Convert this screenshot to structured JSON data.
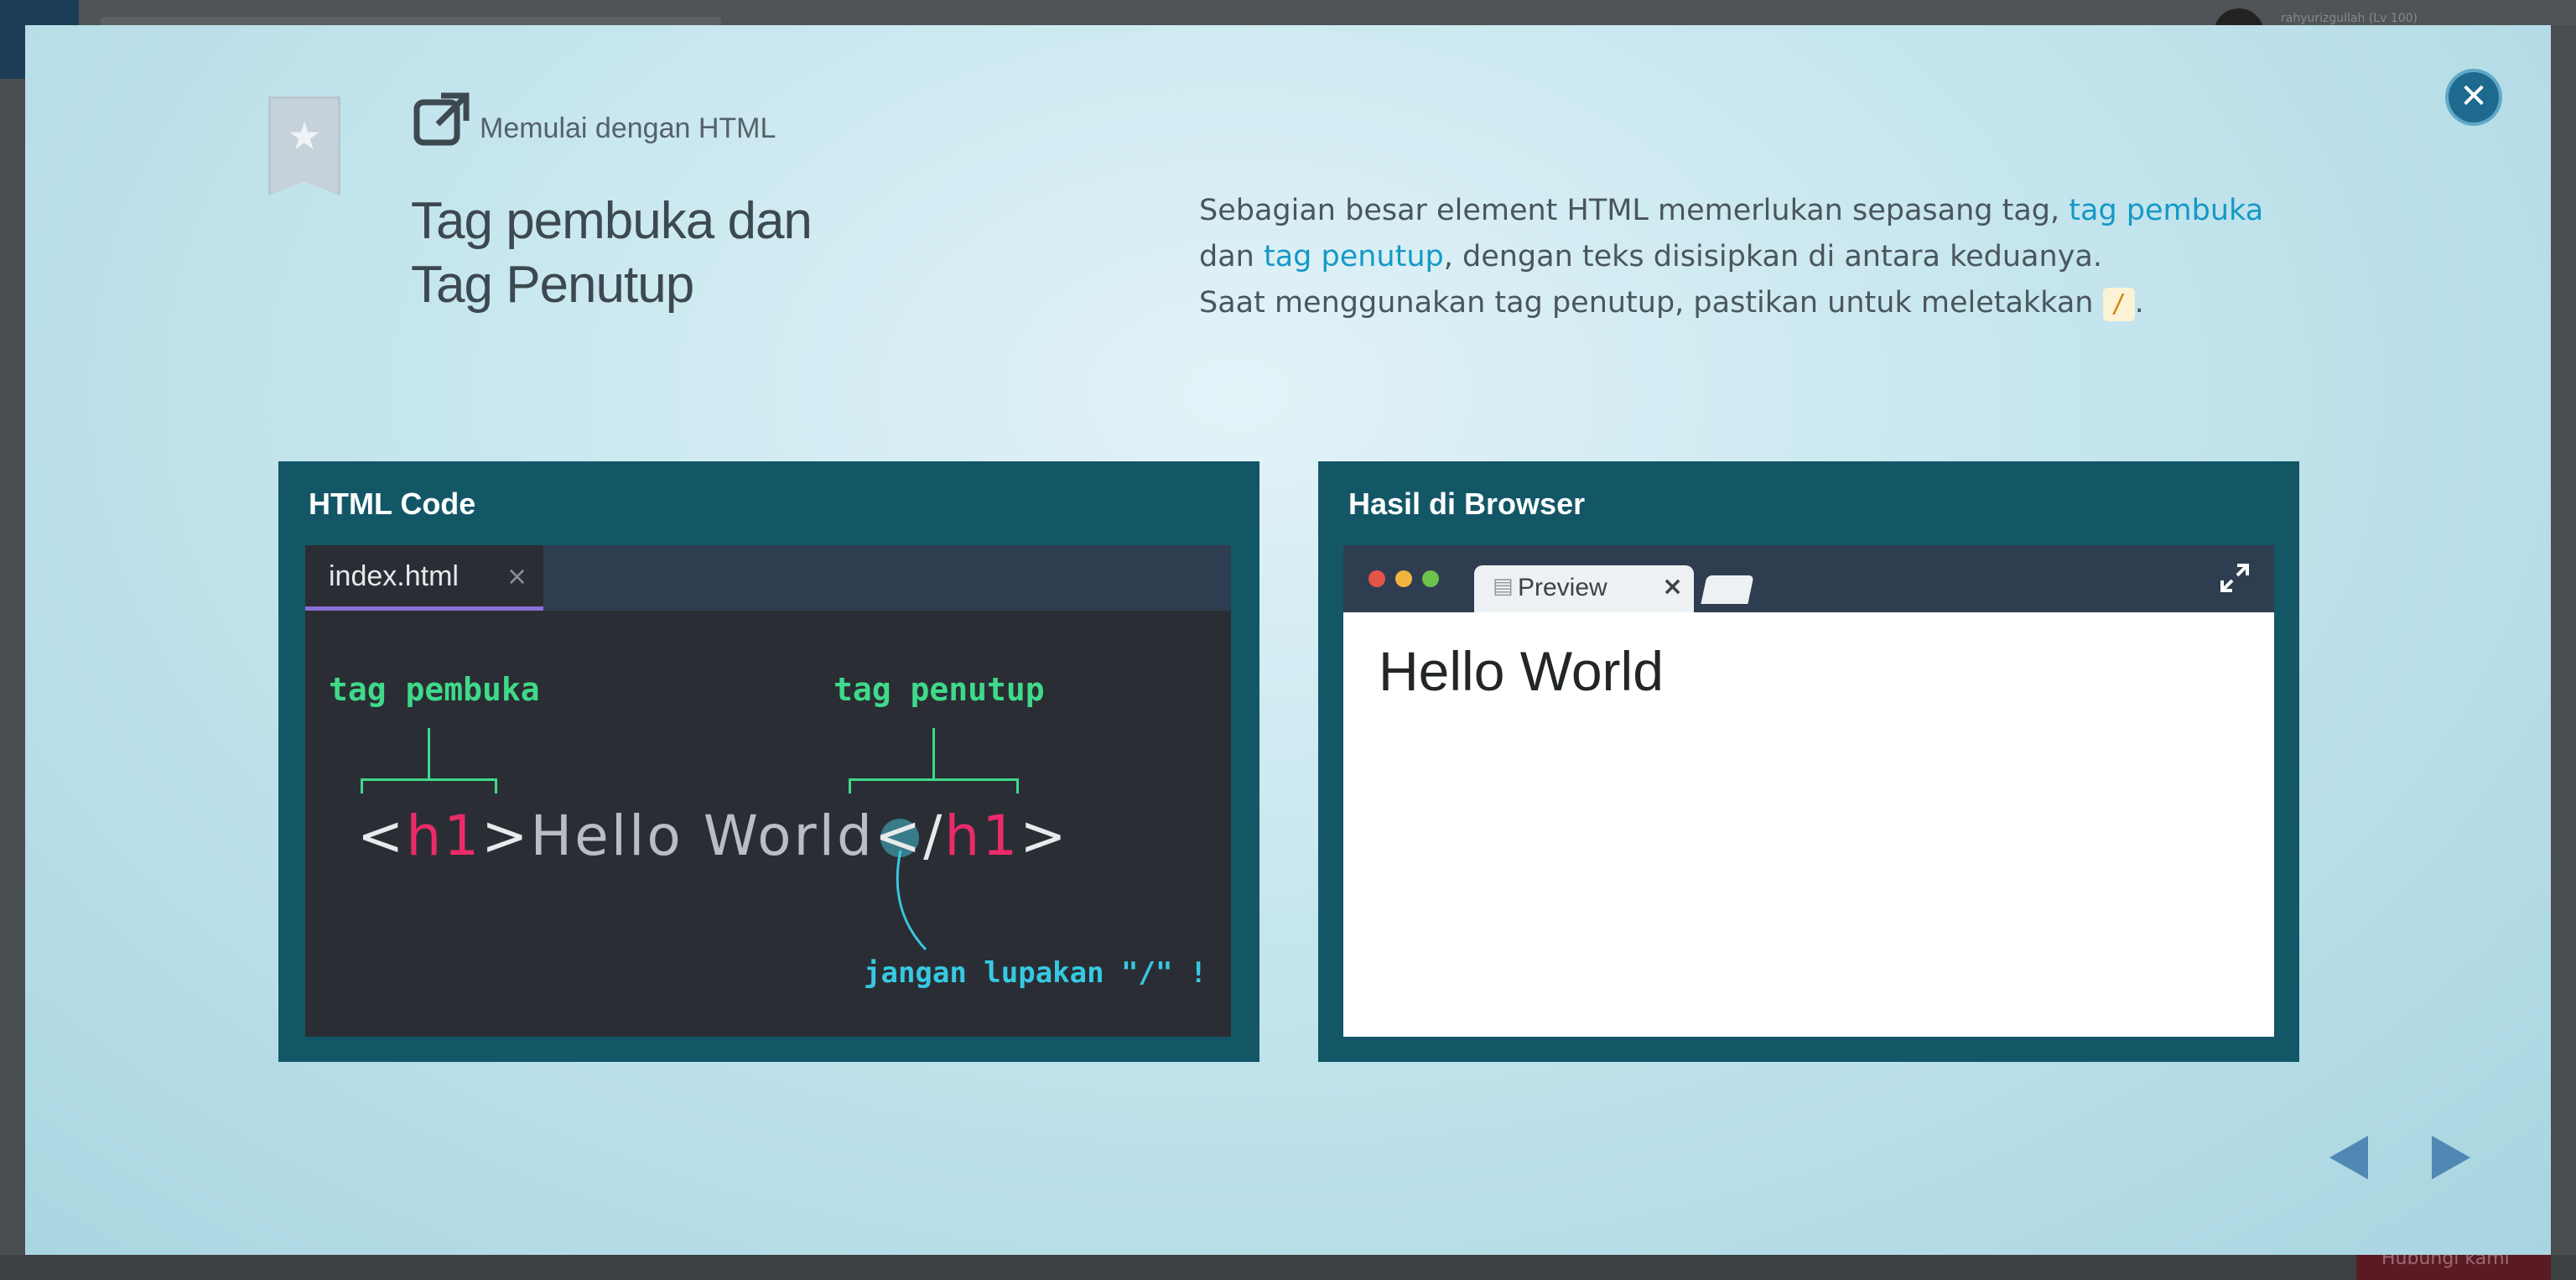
{
  "background": {
    "user_label": "rahyurizgullah (Lv 100)",
    "bottom_button_label": "Hubungi kami"
  },
  "modal": {
    "subtitle": "Memulai dengan HTML",
    "title_line1": "Tag pembuka dan",
    "title_line2": "Tag Penutup",
    "description": {
      "line1_pre": "Sebagian besar element HTML memerlukan sepasang tag, ",
      "line1_hl": "tag pembuka",
      "line2_pre": "dan ",
      "line2_hl": "tag penutup",
      "line2_post": ", dengan teks disisipkan di antara keduanya.",
      "line3_pre": "Saat menggunakan tag penutup, pastikan untuk meletakkan ",
      "line3_code": "/",
      "line3_post": "."
    },
    "close_icon": "close-icon",
    "accent_color": "#1499c6"
  },
  "code_panel": {
    "title": "HTML Code",
    "tab_label": "index.html",
    "tab_close": "×",
    "label_open": "tag pembuka",
    "label_close": "tag penutup",
    "code": {
      "lt1": "<",
      "tag1": "h1",
      "gt1": ">",
      "text": "Hello World",
      "lt2": "<",
      "slash": "/",
      "tag2": "h1",
      "gt2": ">"
    },
    "reminder": "jangan lupakan \"/\" !"
  },
  "browser_panel": {
    "title": "Hasil di Browser",
    "tab_label": "Preview",
    "tab_close": "×",
    "content": "Hello World"
  },
  "navigation": {
    "prev_icon": "triangle-left-icon",
    "next_icon": "triangle-right-icon"
  }
}
